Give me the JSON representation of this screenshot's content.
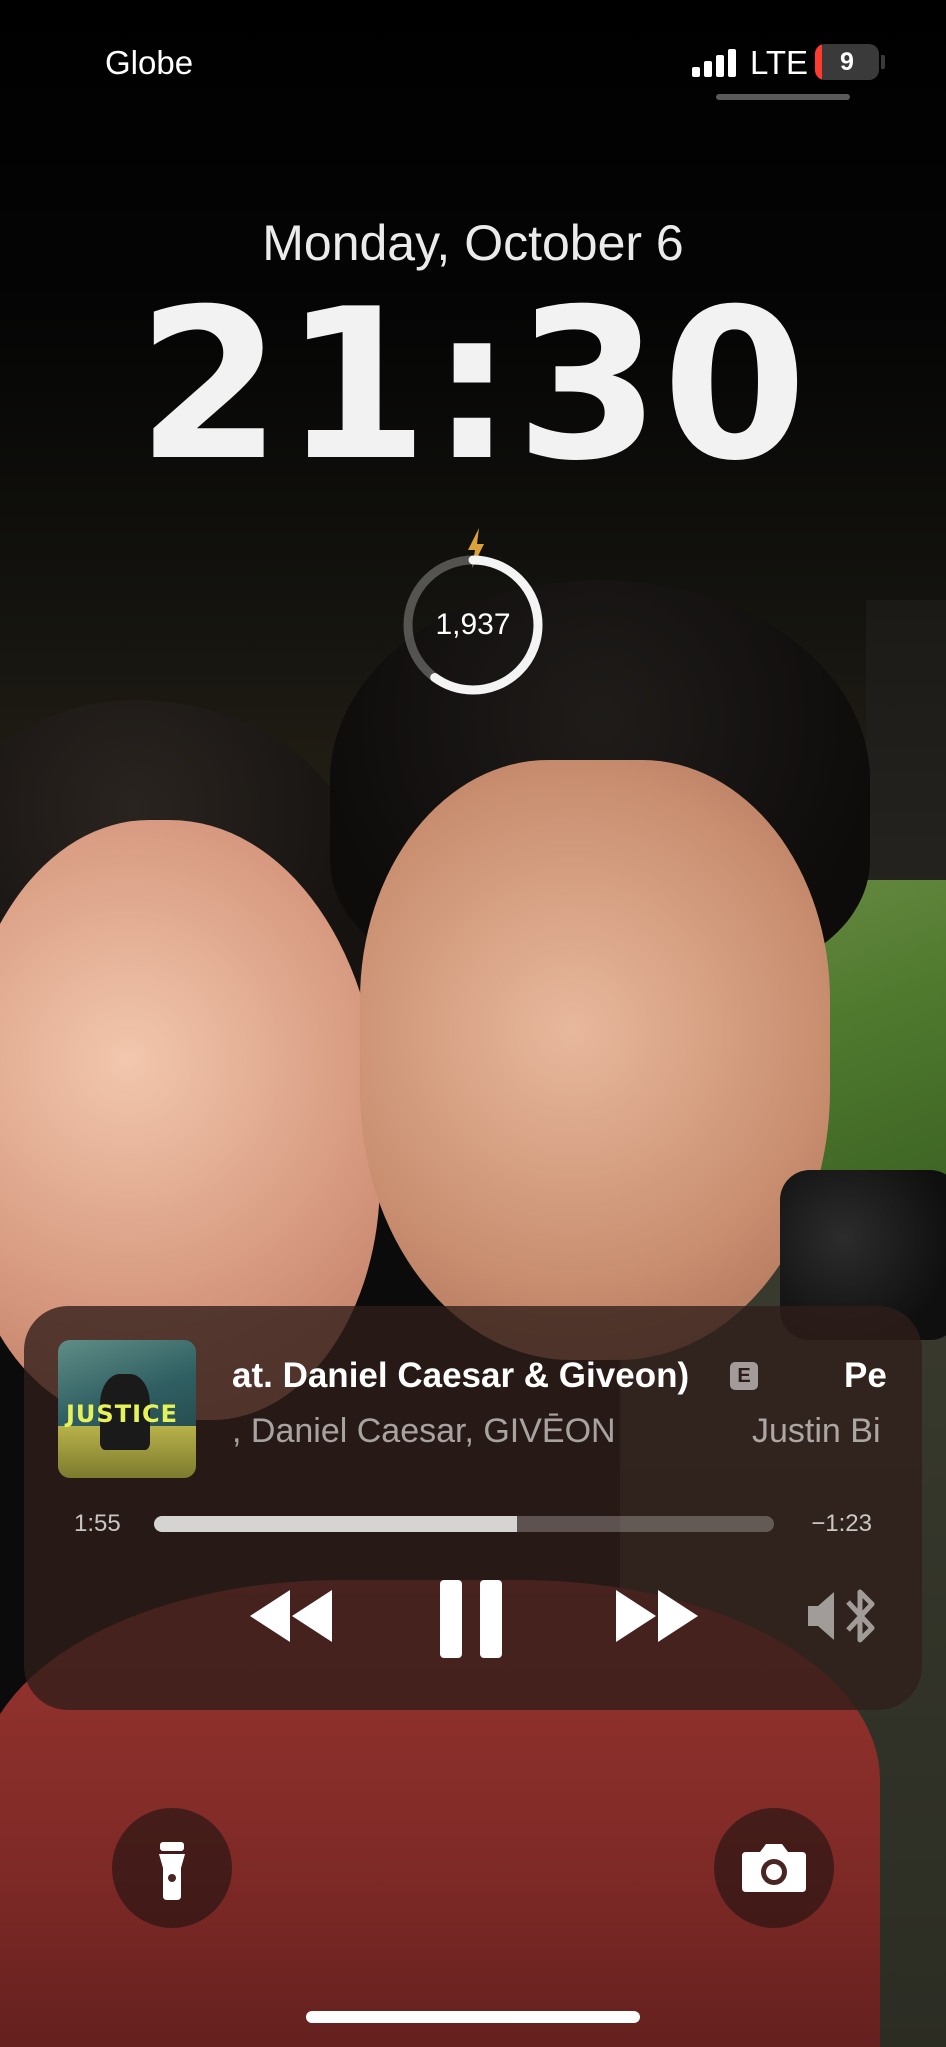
{
  "status_bar": {
    "carrier": "Globe",
    "network": "LTE",
    "battery_level": "9"
  },
  "lock_screen": {
    "date": "Monday, October 6",
    "time": "21:30"
  },
  "widget": {
    "value": "1,937",
    "progress_fraction": 0.6
  },
  "now_playing": {
    "title_visible": "at. Daniel Caesar & Giveon)",
    "explicit_badge": "E",
    "next_title_visible": "Pe",
    "artist_visible": ", Daniel Caesar, GIVĒON",
    "next_artist_visible": "Justin Bi",
    "elapsed": "1:55",
    "remaining": "−1:23",
    "progress_fraction": 0.586
  },
  "icons": {
    "rewind": "rewind-icon",
    "pause": "pause-icon",
    "forward": "fast-forward-icon",
    "audio_route": "speaker-bluetooth-icon",
    "flashlight": "flashlight-icon",
    "camera": "camera-icon"
  }
}
